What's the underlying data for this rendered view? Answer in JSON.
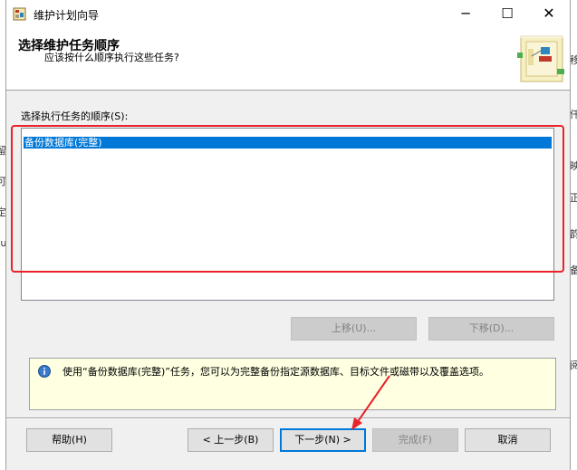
{
  "window": {
    "title": "维护计划向导",
    "minimize_glyph": "─",
    "maximize_glyph": "☐",
    "close_glyph": "✕"
  },
  "header": {
    "title": "选择维护任务顺序",
    "subtitle": "应该按什么顺序执行这些任务?"
  },
  "task_list": {
    "label": "选择执行任务的顺序(S):",
    "items": [
      "备份数据库(完整)"
    ]
  },
  "buttons": {
    "move_up": "上移(U)...",
    "move_down": "下移(D)...",
    "help": "帮助(H)",
    "back": "< 上一步(B)",
    "next": "下一步(N) >",
    "finish": "完成(F)",
    "cancel": "取消"
  },
  "info": {
    "text": "使用“备份数据库(完整)”任务，您可以为完整备份指定源数据库、目标文件或磁带以及覆盖选项。"
  },
  "colors": {
    "selection": "#0078d7",
    "highlight": "#e8232a",
    "info_background": "#ffffe1"
  }
}
